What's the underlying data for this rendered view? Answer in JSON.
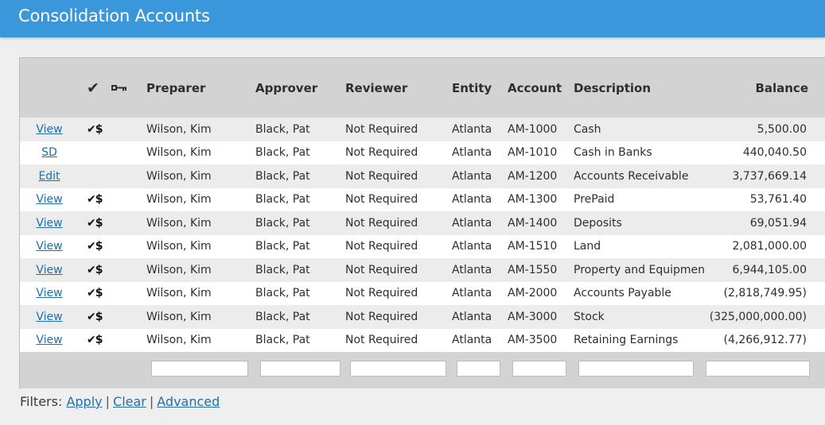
{
  "title": "Consolidation Accounts",
  "header": {
    "check_icon": "check-icon",
    "key_icon": "key-icon",
    "preparer": "Preparer",
    "approver": "Approver",
    "reviewer": "Reviewer",
    "entity": "Entity",
    "account": "Account",
    "description": "Description",
    "balance": "Balance"
  },
  "rows": [
    {
      "action": "View",
      "mark": "✔$",
      "preparer": "Wilson, Kim",
      "approver": "Black, Pat",
      "reviewer": "Not Required",
      "entity": "Atlanta",
      "account": "AM-1000",
      "description": "Cash",
      "balance": "5,500.00"
    },
    {
      "action": "SD",
      "mark": "",
      "preparer": "Wilson, Kim",
      "approver": "Black, Pat",
      "reviewer": "Not Required",
      "entity": "Atlanta",
      "account": "AM-1010",
      "description": "Cash in Banks",
      "balance": "440,040.50"
    },
    {
      "action": "Edit",
      "mark": "",
      "preparer": "Wilson, Kim",
      "approver": "Black, Pat",
      "reviewer": "Not Required",
      "entity": "Atlanta",
      "account": "AM-1200",
      "description": "Accounts Receivable",
      "balance": "3,737,669.14"
    },
    {
      "action": "View",
      "mark": "✔$",
      "preparer": "Wilson, Kim",
      "approver": "Black, Pat",
      "reviewer": "Not Required",
      "entity": "Atlanta",
      "account": "AM-1300",
      "description": "PrePaid",
      "balance": "53,761.40"
    },
    {
      "action": "View",
      "mark": "✔$",
      "preparer": "Wilson, Kim",
      "approver": "Black, Pat",
      "reviewer": "Not Required",
      "entity": "Atlanta",
      "account": "AM-1400",
      "description": "Deposits",
      "balance": "69,051.94"
    },
    {
      "action": "View",
      "mark": "✔$",
      "preparer": "Wilson, Kim",
      "approver": "Black, Pat",
      "reviewer": "Not Required",
      "entity": "Atlanta",
      "account": "AM-1510",
      "description": "Land",
      "balance": "2,081,000.00"
    },
    {
      "action": "View",
      "mark": "✔$",
      "preparer": "Wilson, Kim",
      "approver": "Black, Pat",
      "reviewer": "Not Required",
      "entity": "Atlanta",
      "account": "AM-1550",
      "description": "Property and Equipment",
      "balance": "6,944,105.00"
    },
    {
      "action": "View",
      "mark": "✔$",
      "preparer": "Wilson, Kim",
      "approver": "Black, Pat",
      "reviewer": "Not Required",
      "entity": "Atlanta",
      "account": "AM-2000",
      "description": "Accounts Payable",
      "balance": "(2,818,749.95)"
    },
    {
      "action": "View",
      "mark": "✔$",
      "preparer": "Wilson, Kim",
      "approver": "Black, Pat",
      "reviewer": "Not Required",
      "entity": "Atlanta",
      "account": "AM-3000",
      "description": "Stock",
      "balance": "(325,000,000.00)"
    },
    {
      "action": "View",
      "mark": "✔$",
      "preparer": "Wilson, Kim",
      "approver": "Black, Pat",
      "reviewer": "Not Required",
      "entity": "Atlanta",
      "account": "AM-3500",
      "description": "Retaining Earnings",
      "balance": "(4,266,912.77)"
    }
  ],
  "filters": {
    "label": "Filters:",
    "apply": "Apply",
    "clear": "Clear",
    "advanced": "Advanced",
    "separator": "|",
    "inputs": {
      "preparer": "",
      "approver": "",
      "reviewer": "",
      "entity": "",
      "account": "",
      "description": "",
      "balance": ""
    }
  },
  "colors": {
    "titlebar": "#3a97d9",
    "link": "#1f6fa8",
    "row_alt": "#ececec",
    "header_bg": "#d4d3d3"
  }
}
